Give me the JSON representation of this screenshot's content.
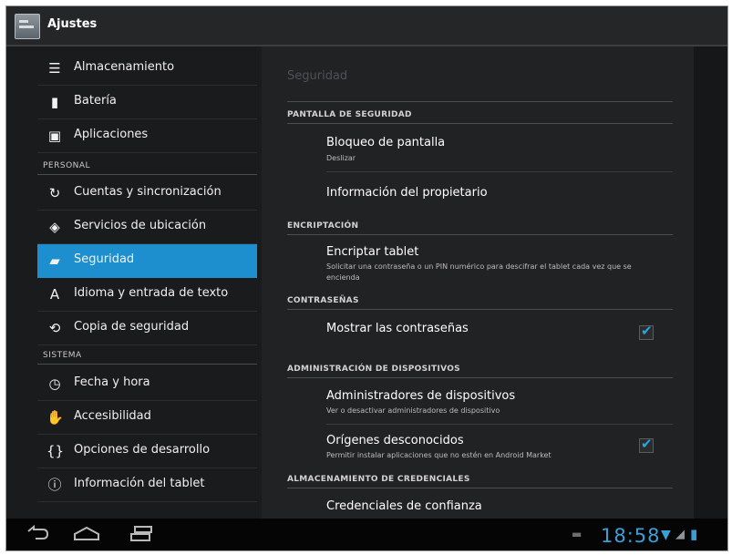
{
  "app": {
    "title": "Ajustes",
    "icon": "settings-app-icon"
  },
  "sidebar": {
    "items": [
      {
        "label": "Almacenamiento",
        "icon": "storage-icon"
      },
      {
        "label": "Batería",
        "icon": "battery-icon"
      },
      {
        "label": "Aplicaciones",
        "icon": "apps-icon"
      }
    ],
    "section_personal": "PERSONAL",
    "personal_items": [
      {
        "label": "Cuentas y sincronización",
        "icon": "sync-icon"
      },
      {
        "label": "Servicios de ubicación",
        "icon": "location-icon"
      },
      {
        "label": "Seguridad",
        "icon": "lock-icon",
        "active": true
      },
      {
        "label": "Idioma y entrada de texto",
        "icon": "language-icon"
      },
      {
        "label": "Copia de seguridad",
        "icon": "backup-icon"
      }
    ],
    "section_sistema": "SISTEMA",
    "system_items": [
      {
        "label": "Fecha y hora",
        "icon": "clock-icon"
      },
      {
        "label": "Accesibilidad",
        "icon": "hand-icon"
      },
      {
        "label": "Opciones de desarrollo",
        "icon": "braces-icon"
      },
      {
        "label": "Información del tablet",
        "icon": "info-icon"
      }
    ]
  },
  "content": {
    "title": "Seguridad",
    "sections": [
      {
        "header": "PANTALLA DE SEGURIDAD",
        "rows": [
          {
            "title": "Bloqueo de pantalla",
            "subtitle": "Deslizar"
          },
          {
            "title": "Información del propietario",
            "subtitle": ""
          }
        ]
      },
      {
        "header": "ENCRIPTACIÓN",
        "rows": [
          {
            "title": "Encriptar tablet",
            "subtitle": "Solicitar una contraseña o un PIN numérico para descifrar el tablet cada vez que se encienda"
          }
        ]
      },
      {
        "header": "CONTRASEÑAS",
        "rows": [
          {
            "title": "Mostrar las contraseñas",
            "subtitle": "",
            "checked": true
          }
        ]
      },
      {
        "header": "ADMINISTRACIÓN DE DISPOSITIVOS",
        "rows": [
          {
            "title": "Administradores de dispositivos",
            "subtitle": "Ver o desactivar administradores de dispositivo"
          },
          {
            "title": "Orígenes desconocidos",
            "subtitle": "Permitir instalar aplicaciones que no estén en Android Market",
            "checked": true
          }
        ]
      },
      {
        "header": "ALMACENAMIENTO DE CREDENCIALES",
        "rows": [
          {
            "title": "Credenciales de confianza",
            "subtitle": ""
          }
        ]
      }
    ]
  },
  "navbar": {
    "clock": "18:58",
    "icons": [
      "back-icon",
      "home-icon",
      "recents-icon",
      "notification-icon",
      "wifi-icon",
      "signal-icon",
      "battery-status-icon"
    ]
  },
  "colors": {
    "accent": "#1d8fcf",
    "clock": "#3a9fd7"
  }
}
